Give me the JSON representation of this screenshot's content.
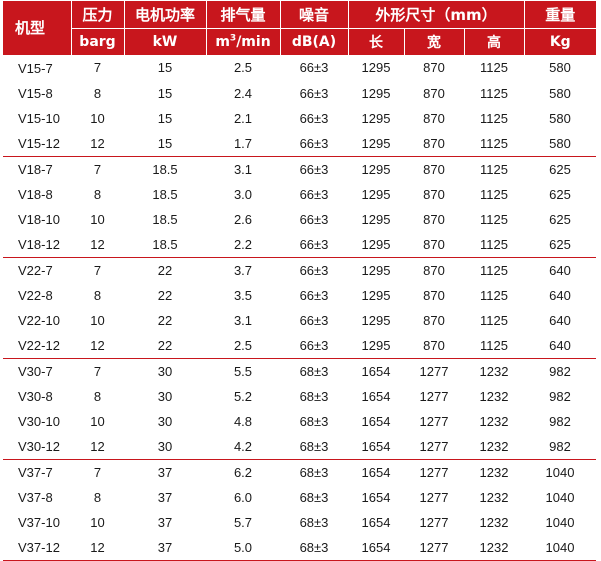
{
  "header": {
    "model": "机型",
    "pressure": "压力",
    "power": "电机功率",
    "capacity": "排气量",
    "noise": "噪音",
    "dimensions": "外形尺寸（mm）",
    "weight": "重量",
    "pressure_unit": "barg",
    "power_unit": "kW",
    "capacity_unit_base": "m",
    "capacity_unit_sup": "3",
    "capacity_unit_tail": "/min",
    "noise_unit": "dB(A)",
    "length": "长",
    "width": "宽",
    "height": "高",
    "weight_unit": "Kg"
  },
  "rows": [
    [
      "V15-7",
      "7",
      "15",
      "2.5",
      "66±3",
      "1295",
      "870",
      "1125",
      "580"
    ],
    [
      "V15-8",
      "8",
      "15",
      "2.4",
      "66±3",
      "1295",
      "870",
      "1125",
      "580"
    ],
    [
      "V15-10",
      "10",
      "15",
      "2.1",
      "66±3",
      "1295",
      "870",
      "1125",
      "580"
    ],
    [
      "V15-12",
      "12",
      "15",
      "1.7",
      "66±3",
      "1295",
      "870",
      "1125",
      "580"
    ],
    [
      "V18-7",
      "7",
      "18.5",
      "3.1",
      "66±3",
      "1295",
      "870",
      "1125",
      "625"
    ],
    [
      "V18-8",
      "8",
      "18.5",
      "3.0",
      "66±3",
      "1295",
      "870",
      "1125",
      "625"
    ],
    [
      "V18-10",
      "10",
      "18.5",
      "2.6",
      "66±3",
      "1295",
      "870",
      "1125",
      "625"
    ],
    [
      "V18-12",
      "12",
      "18.5",
      "2.2",
      "66±3",
      "1295",
      "870",
      "1125",
      "625"
    ],
    [
      "V22-7",
      "7",
      "22",
      "3.7",
      "66±3",
      "1295",
      "870",
      "1125",
      "640"
    ],
    [
      "V22-8",
      "8",
      "22",
      "3.5",
      "66±3",
      "1295",
      "870",
      "1125",
      "640"
    ],
    [
      "V22-10",
      "10",
      "22",
      "3.1",
      "66±3",
      "1295",
      "870",
      "1125",
      "640"
    ],
    [
      "V22-12",
      "12",
      "22",
      "2.5",
      "66±3",
      "1295",
      "870",
      "1125",
      "640"
    ],
    [
      "V30-7",
      "7",
      "30",
      "5.5",
      "68±3",
      "1654",
      "1277",
      "1232",
      "982"
    ],
    [
      "V30-8",
      "8",
      "30",
      "5.2",
      "68±3",
      "1654",
      "1277",
      "1232",
      "982"
    ],
    [
      "V30-10",
      "10",
      "30",
      "4.8",
      "68±3",
      "1654",
      "1277",
      "1232",
      "982"
    ],
    [
      "V30-12",
      "12",
      "30",
      "4.2",
      "68±3",
      "1654",
      "1277",
      "1232",
      "982"
    ],
    [
      "V37-7",
      "7",
      "37",
      "6.2",
      "68±3",
      "1654",
      "1277",
      "1232",
      "1040"
    ],
    [
      "V37-8",
      "8",
      "37",
      "6.0",
      "68±3",
      "1654",
      "1277",
      "1232",
      "1040"
    ],
    [
      "V37-10",
      "10",
      "37",
      "5.7",
      "68±3",
      "1654",
      "1277",
      "1232",
      "1040"
    ],
    [
      "V37-12",
      "12",
      "37",
      "5.0",
      "68±3",
      "1654",
      "1277",
      "1232",
      "1040"
    ]
  ]
}
